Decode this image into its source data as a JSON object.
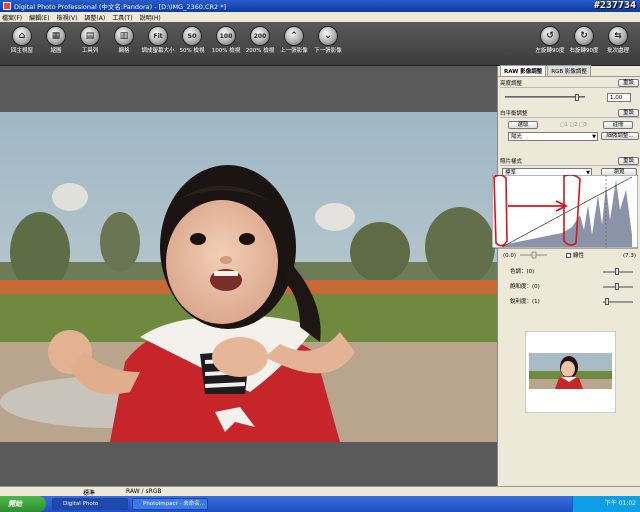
{
  "window": {
    "title": "Digital Photo Professional (中文名:Pandora) - [D:\\IMG_2360.CR2 *]",
    "watermark": "#237734"
  },
  "menu": [
    "檔案(F)",
    "編輯(E)",
    "檢視(V)",
    "調整(A)",
    "工具(T)",
    "說明(H)"
  ],
  "toolbar": {
    "buttons": [
      {
        "label": "回主視窗",
        "icon": "home-icon",
        "glyph": "⌂"
      },
      {
        "label": "縮圖",
        "icon": "thumbnail-icon",
        "glyph": "▦"
      },
      {
        "label": "工具列",
        "icon": "tool-palette-icon",
        "glyph": "▤"
      },
      {
        "label": "網格",
        "icon": "grid-icon",
        "glyph": "▥"
      },
      {
        "label": "調成螢幕大小",
        "icon": "fit-screen-icon",
        "glyph": "Fit"
      },
      {
        "label": "50% 檢視",
        "icon": "zoom-50-icon",
        "glyph": "50"
      },
      {
        "label": "100% 檢視",
        "icon": "zoom-100-icon",
        "glyph": "100"
      },
      {
        "label": "200% 檢視",
        "icon": "zoom-200-icon",
        "glyph": "200"
      },
      {
        "label": "上一張影像",
        "icon": "previous-image-icon",
        "glyph": "⌃"
      },
      {
        "label": "下一張影像",
        "icon": "next-image-icon",
        "glyph": "⌄"
      }
    ],
    "right_buttons": [
      {
        "label": "左旋轉90度",
        "icon": "rotate-left-icon",
        "glyph": "↺"
      },
      {
        "label": "右旋轉90度",
        "icon": "rotate-right-icon",
        "glyph": "↻"
      },
      {
        "label": "批次處理",
        "icon": "batch-process-icon",
        "glyph": "⇆"
      }
    ]
  },
  "panel": {
    "tabs": [
      "RAW 影像調整",
      "RGB 影像調整"
    ],
    "brightness": {
      "label": "亮度調整",
      "reset": "重設",
      "value": "1.00"
    },
    "white_balance": {
      "label": "白平衡調整",
      "reset": "重設",
      "eyedropper": "選取",
      "register": "註冊",
      "preset": "陽光",
      "fine_tune": "細微調整..."
    },
    "picture_style": {
      "label": "照片樣式",
      "reset": "重設",
      "style": "標準",
      "browse": "瀏覽",
      "linear_label": "線性",
      "range_low": "(0.0)",
      "range_high": "(7.3)"
    },
    "tone": {
      "label": "色調：(0)"
    },
    "saturation": {
      "label": "飽和度：(0)"
    },
    "sharpness": {
      "label": "銳利度：(1)"
    }
  },
  "status": {
    "left": "標準",
    "right": "RAW / sRGB"
  },
  "taskbar": {
    "start": "開始",
    "tasks": [
      "Digital Photo Professio...",
      "PhotoImpact - 未命名..."
    ],
    "clock": "下午 01:02"
  },
  "colors": {
    "accent_red": "#d8141c",
    "window_title_blue": "#0b3aa6"
  }
}
